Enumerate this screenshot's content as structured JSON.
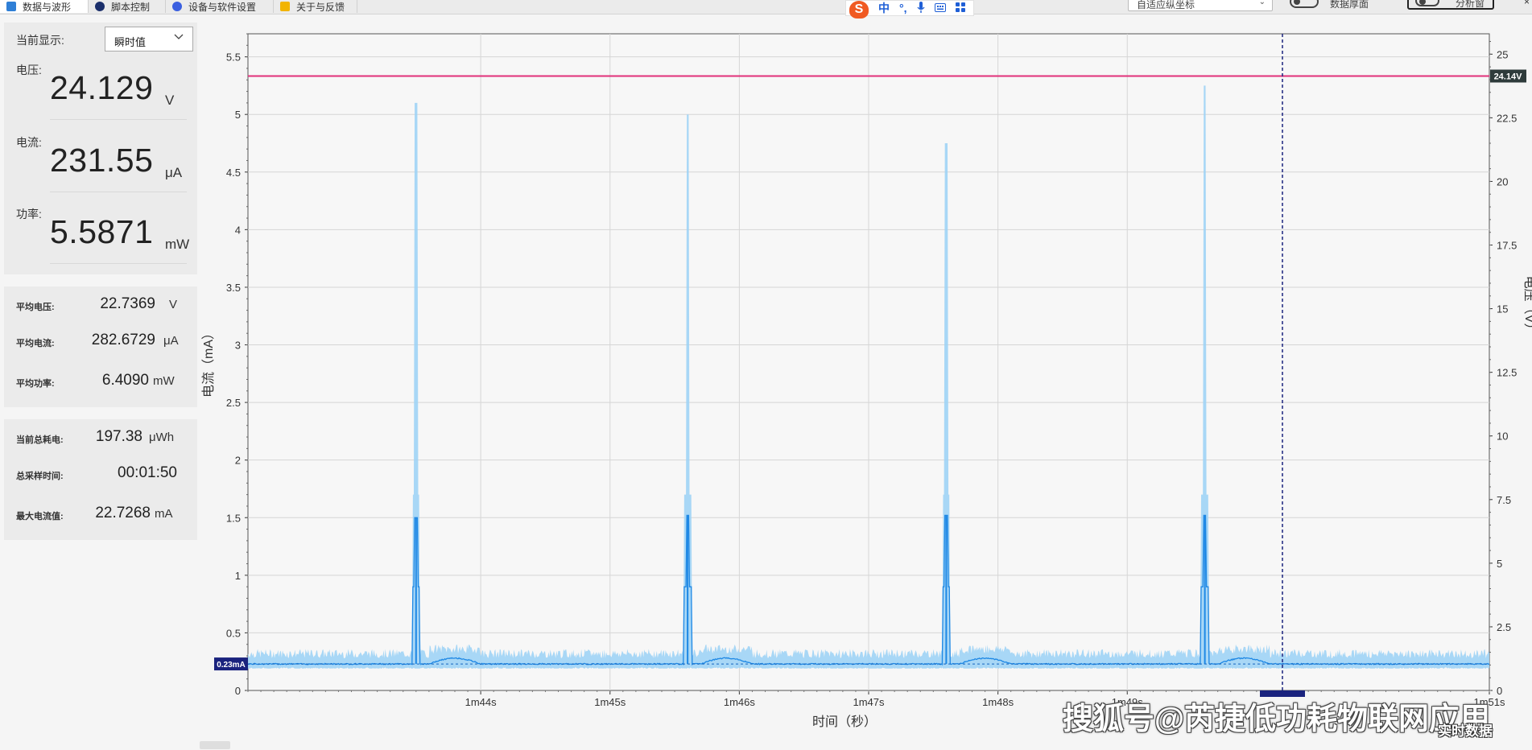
{
  "tabs": [
    {
      "label": "数据与波形",
      "icon": "waveform-icon",
      "color": "#2f7fd6",
      "active": true
    },
    {
      "label": "脚本控制",
      "icon": "script-icon",
      "color": "#1b2f6b",
      "active": false
    },
    {
      "label": "设备与软件设置",
      "icon": "settings-icon",
      "color": "#3a5fe0",
      "active": false
    },
    {
      "label": "关于与反馈",
      "icon": "feedback-icon",
      "color": "#f2b400",
      "active": false
    }
  ],
  "ime": {
    "logo": "S",
    "mode": "中",
    "punct": "°,",
    "icons": [
      "mic-icon",
      "keyboard-icon",
      "grid-icon"
    ]
  },
  "toolbar": {
    "axis_select": "自适应纵坐标",
    "data_thickness_label": "数据厚面",
    "analysis_label": "分析窗",
    "close_glyph": "×"
  },
  "left": {
    "current_display_label": "当前显示:",
    "current_display_value": "瞬时值",
    "voltage": {
      "label": "电压:",
      "value": "24.129",
      "unit": "V"
    },
    "current": {
      "label": "电流:",
      "value": "231.55",
      "unit": "μA"
    },
    "power": {
      "label": "功率:",
      "value": "5.5871",
      "unit": "mW"
    },
    "avg": [
      {
        "label": "平均电压:",
        "value": "22.7369",
        "unit": "V"
      },
      {
        "label": "平均电流:",
        "value": "282.6729",
        "unit": "μA"
      },
      {
        "label": "平均功率:",
        "value": "6.4090",
        "unit": "mW"
      }
    ],
    "totals": [
      {
        "label": "当前总耗电:",
        "value": "197.38",
        "unit": "μWh"
      },
      {
        "label": "总采样时间:",
        "value": "00:01:50",
        "unit": ""
      },
      {
        "label": "最大电流值:",
        "value": "22.7268",
        "unit": "mA"
      }
    ]
  },
  "chart_data": {
    "type": "line",
    "xlabel": "时间（秒）",
    "ylabel": "电流（mA）",
    "y2label": "电压（V）",
    "x_ticks": [
      "1m44s",
      "1m45s",
      "1m46s",
      "1m47s",
      "1m48s",
      "1m49s",
      "1m51s"
    ],
    "ylim": [
      0,
      5.7
    ],
    "y_ticks": [
      0,
      0.5,
      1,
      1.5,
      2,
      2.5,
      3,
      3.5,
      4,
      4.5,
      5,
      5.5
    ],
    "y2lim": [
      0,
      25.8
    ],
    "y2_ticks": [
      0,
      2.5,
      5,
      7.5,
      10,
      12.5,
      15,
      17.5,
      20,
      22.5,
      25
    ],
    "grid": true,
    "series": [
      {
        "name": "电压",
        "axis": "right",
        "color": "#e0307a",
        "baseline": 24.14
      },
      {
        "name": "电流",
        "axis": "left",
        "color": "#1e88e5",
        "fill_color": "#9fd3f5",
        "baseline": 0.23,
        "spikes": [
          {
            "x": "1m43.3s",
            "peak": 1.5,
            "envelope_peak": 5.1
          },
          {
            "x": "1m45.4s",
            "peak": 1.52,
            "envelope_peak": 5.0
          },
          {
            "x": "1m47.4s",
            "peak": 1.52,
            "envelope_peak": 4.75
          },
          {
            "x": "1m49.4s",
            "peak": 1.52,
            "envelope_peak": 5.25
          }
        ]
      }
    ],
    "markers": {
      "voltage_label": "24.14V",
      "current_label": "0.23mA",
      "cursor_x": "1m50.0s"
    }
  },
  "watermark": "搜狐号@芮捷低功耗物联网应用",
  "watermark2": "实时数据"
}
